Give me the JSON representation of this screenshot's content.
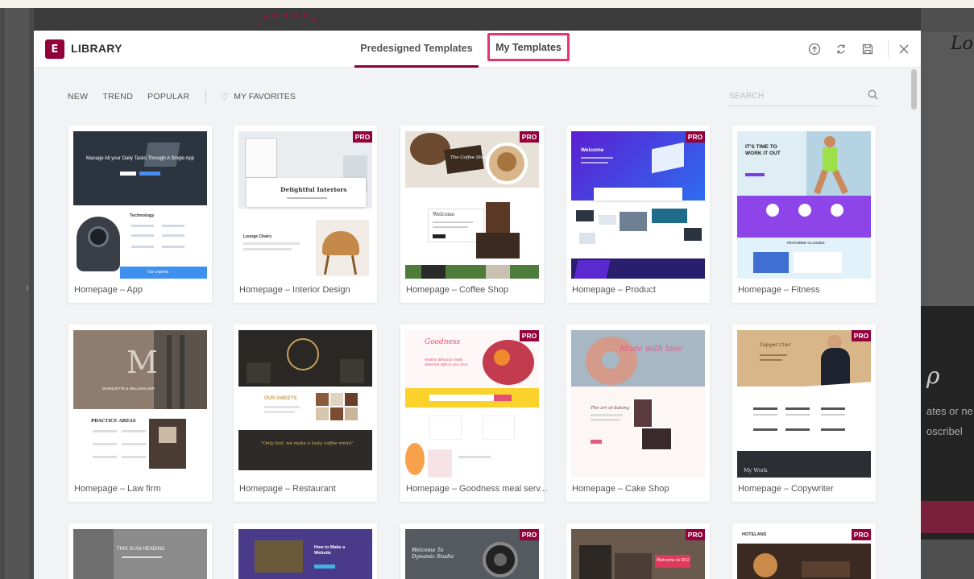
{
  "background": {
    "logo_text": "Log",
    "text_lines": [
      "ates or ne",
      "oscribel"
    ]
  },
  "header": {
    "title": "LIBRARY",
    "logo_glyph": "E",
    "tabs": [
      {
        "label": "Predesigned Templates"
      },
      {
        "label": "My Templates"
      }
    ]
  },
  "filters": {
    "items": [
      "NEW",
      "TREND",
      "POPULAR"
    ],
    "favorites": "MY FAVORITES",
    "search_placeholder": "SEARCH"
  },
  "pro_badge": "PRO",
  "templates": [
    {
      "name": "Homepage – App",
      "pro": false
    },
    {
      "name": "Homepage – Interior Design",
      "pro": true
    },
    {
      "name": "Homepage – Coffee Shop",
      "pro": true
    },
    {
      "name": "Homepage – Product",
      "pro": true
    },
    {
      "name": "Homepage – Fitness",
      "pro": false
    },
    {
      "name": "Homepage – Law firm",
      "pro": false
    },
    {
      "name": "Homepage – Restaurant",
      "pro": false
    },
    {
      "name": "Homepage – Goodness meal serv...",
      "pro": true
    },
    {
      "name": "Homepage – Cake Shop",
      "pro": true
    },
    {
      "name": "Homepage – Copywriter",
      "pro": true
    },
    {
      "name": "",
      "pro": false
    },
    {
      "name": "",
      "pro": false
    },
    {
      "name": "",
      "pro": true
    },
    {
      "name": "",
      "pro": true
    },
    {
      "name": "",
      "pro": true
    }
  ],
  "thumb_text": {
    "app_headline": "Manage All your Daily Tasks Through A Single App",
    "app_section": "Technology",
    "app_cta": "Our experts",
    "interior_title": "Delightful Interiors",
    "interior_sub": "Lounge Chairs",
    "coffee_logo": "The Coffee Shop",
    "coffee_welcome": "Welcome",
    "product_title": "Welcome",
    "fitness_headline": "IT'S TIME TO WORK IT OUT",
    "fitness_section": "FEATURED CLASSES",
    "law_mono": "M",
    "law_name": "MARQUETTE & MELLENCAMP",
    "law_section": "PRACTICE AREAS",
    "restaurant_section": "OUR SWEETS",
    "restaurant_quote": "\"Only fast, we make a tasty coffee menu\"",
    "goodness_logo": "Goodness",
    "goodness_headline": "Healthy delicious meals delivered right to your door",
    "cake_headline": "Made with love",
    "cake_sub": "The art of baking",
    "copy_title": "Copywriter",
    "copy_name": "My Work",
    "r3_heading": "THIS IS AN HEADING",
    "r3_website": "How to Make a Website",
    "r3_studio": "Welcome To Dynamic Studio",
    "r3_dlv": "Welcome to DLV",
    "r3_hotel": "HOTELANS"
  }
}
